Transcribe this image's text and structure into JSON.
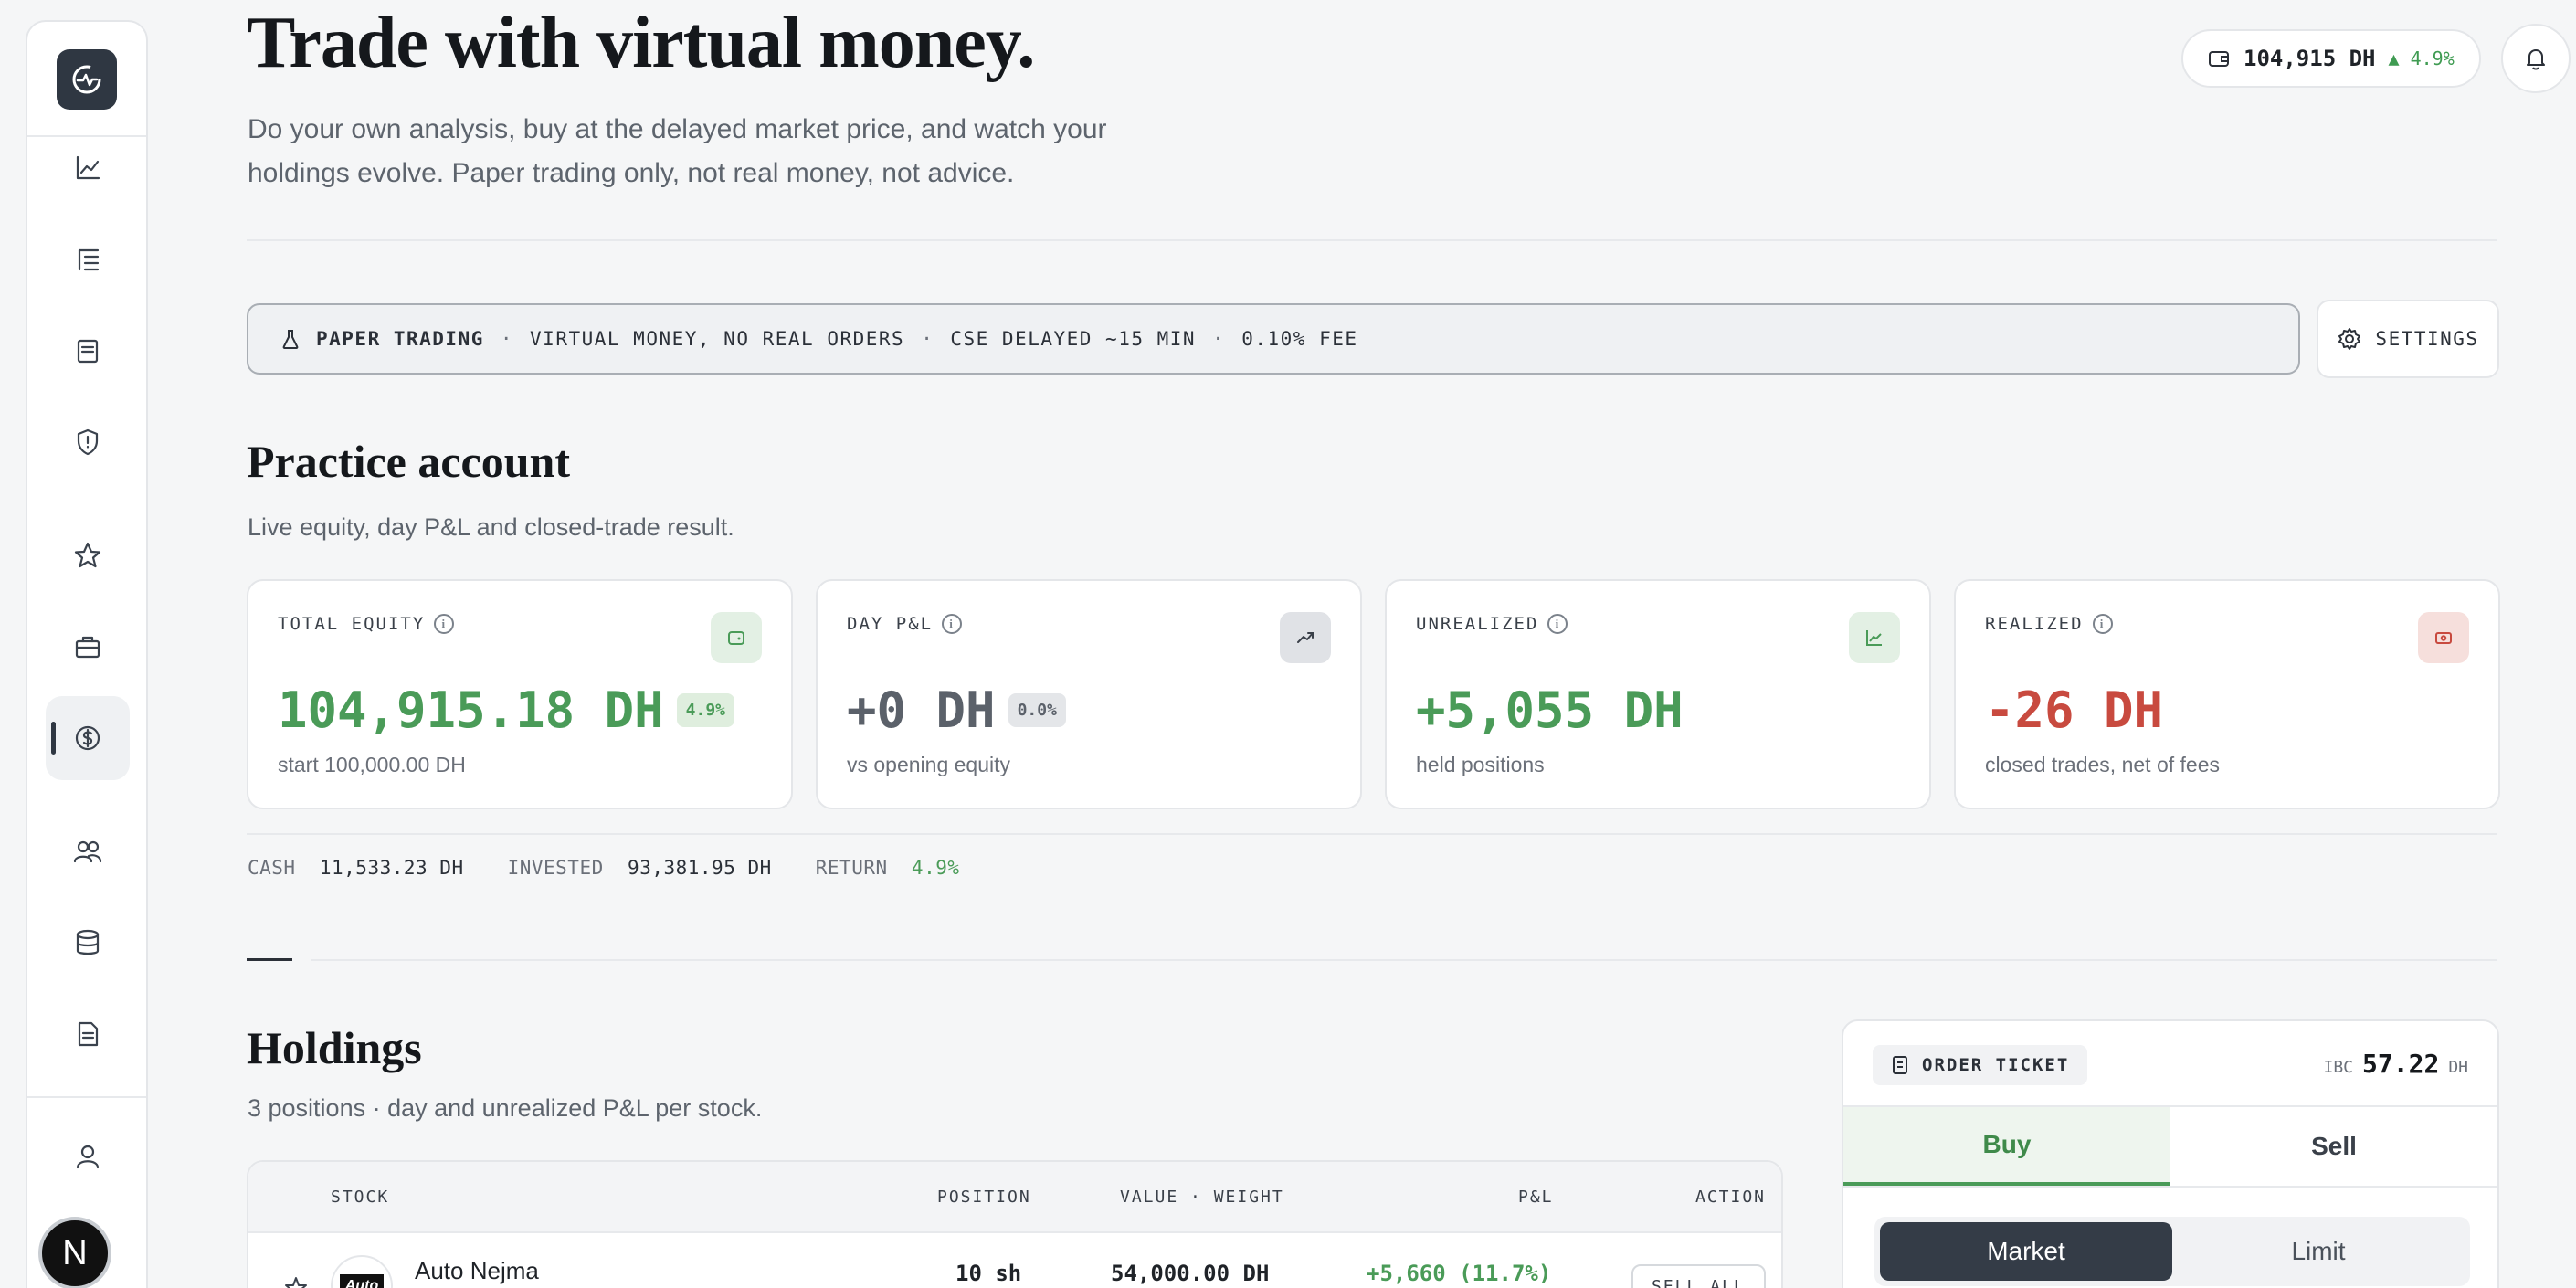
{
  "header": {
    "title": "Trade with virtual money.",
    "subtitle": "Do your own analysis, buy at the delayed market price, and watch your holdings evolve. Paper trading only, not real money, not advice.",
    "balance": "104,915 DH",
    "balance_change": "▲ 4.9%"
  },
  "banner": {
    "label": "PAPER TRADING",
    "items": [
      "VIRTUAL MONEY, NO REAL ORDERS",
      "CSE DELAYED ~15 MIN",
      "0.10% FEE"
    ],
    "separator": "·",
    "settings_label": "SETTINGS"
  },
  "account": {
    "title": "Practice account",
    "subtitle": "Live equity, day P&L and closed-trade result.",
    "cards": [
      {
        "label": "TOTAL EQUITY",
        "value": "104,915.18 DH",
        "badge": "4.9%",
        "note": "start 100,000.00 DH",
        "color": "#4a9b58"
      },
      {
        "label": "DAY P&L",
        "value": "+0 DH",
        "badge": "0.0%",
        "note": "vs opening equity",
        "color": "#5b616a"
      },
      {
        "label": "UNREALIZED",
        "value": "+5,055 DH",
        "note": "held positions",
        "color": "#4a9b58"
      },
      {
        "label": "REALIZED",
        "value": "-26 DH",
        "note": "closed trades, net of fees",
        "color": "#c84a3f"
      }
    ],
    "stats": {
      "cash_label": "CASH",
      "cash": "11,533.23 DH",
      "invested_label": "INVESTED",
      "invested": "93,381.95 DH",
      "return_label": "RETURN",
      "return": "4.9%"
    }
  },
  "holdings": {
    "title": "Holdings",
    "subtitle": "3 positions · day and unrealized P&L per stock.",
    "columns": [
      "STOCK",
      "POSITION",
      "VALUE · WEIGHT",
      "P&L",
      "ACTION"
    ],
    "rows": [
      {
        "logo_text": "Auto",
        "name": "Auto Nejma",
        "position": "10 sh",
        "value": "54,000.00 DH",
        "pnl": "+5,660 (11.7%)",
        "action": "SELL ALL"
      }
    ]
  },
  "ticket": {
    "title": "ORDER TICKET",
    "ticker": "IBC",
    "price": "57.22",
    "unit": "DH",
    "tabs": [
      "Buy",
      "Sell"
    ],
    "order_types": [
      "Market",
      "Limit"
    ]
  },
  "user": {
    "initial": "N"
  }
}
